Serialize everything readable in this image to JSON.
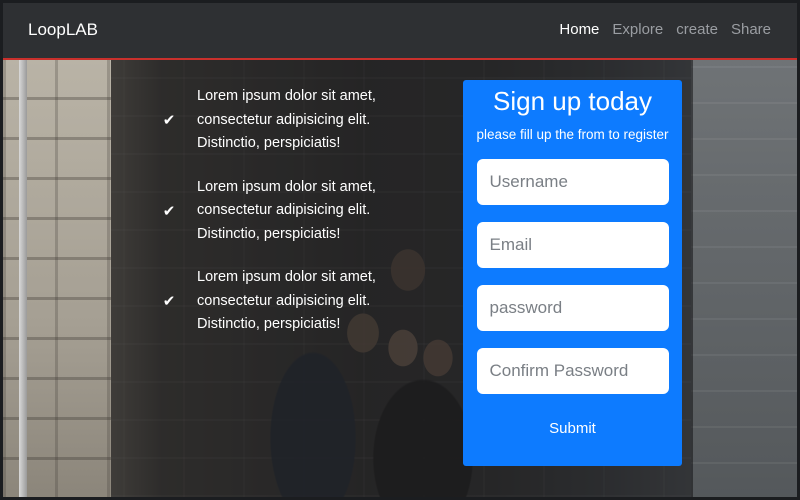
{
  "navbar": {
    "brand": "LoopLAB",
    "links": [
      {
        "label": "Home",
        "active": true
      },
      {
        "label": "Explore",
        "active": false
      },
      {
        "label": "create",
        "active": false
      },
      {
        "label": "Share",
        "active": false
      }
    ]
  },
  "features": [
    {
      "icon": "check-icon",
      "text": "Lorem ipsum dolor sit amet, consectetur adipisicing elit. Distinctio, perspiciatis!"
    },
    {
      "icon": "check-icon",
      "text": "Lorem ipsum dolor sit amet, consectetur adipisicing elit. Distinctio, perspiciatis!"
    },
    {
      "icon": "check-icon",
      "text": "Lorem ipsum dolor sit amet, consectetur adipisicing elit. Distinctio, perspiciatis!"
    }
  ],
  "signup": {
    "title": "Sign up today",
    "subtitle": "please fill up the from to register",
    "fields": {
      "username_placeholder": "Username",
      "email_placeholder": "Email",
      "password_placeholder": "password",
      "confirm_placeholder": "Confirm Password"
    },
    "submit_label": "Submit"
  },
  "colors": {
    "navbar_bg": "#2e3033",
    "navbar_border": "#c9302c",
    "card_bg": "#0d7bff",
    "text": "#ffffff"
  }
}
